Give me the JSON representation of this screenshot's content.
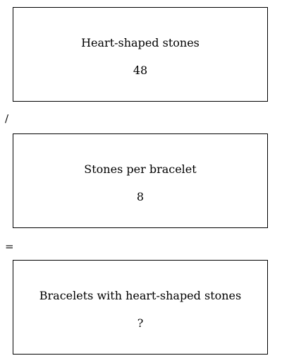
{
  "boxes": [
    {
      "label": "Heart-shaped stones",
      "value": "48"
    },
    {
      "label": "Stones per bracelet",
      "value": "8"
    },
    {
      "label": "Bracelets with heart-shaped stones",
      "value": "?"
    }
  ],
  "operators": [
    "/",
    "="
  ]
}
